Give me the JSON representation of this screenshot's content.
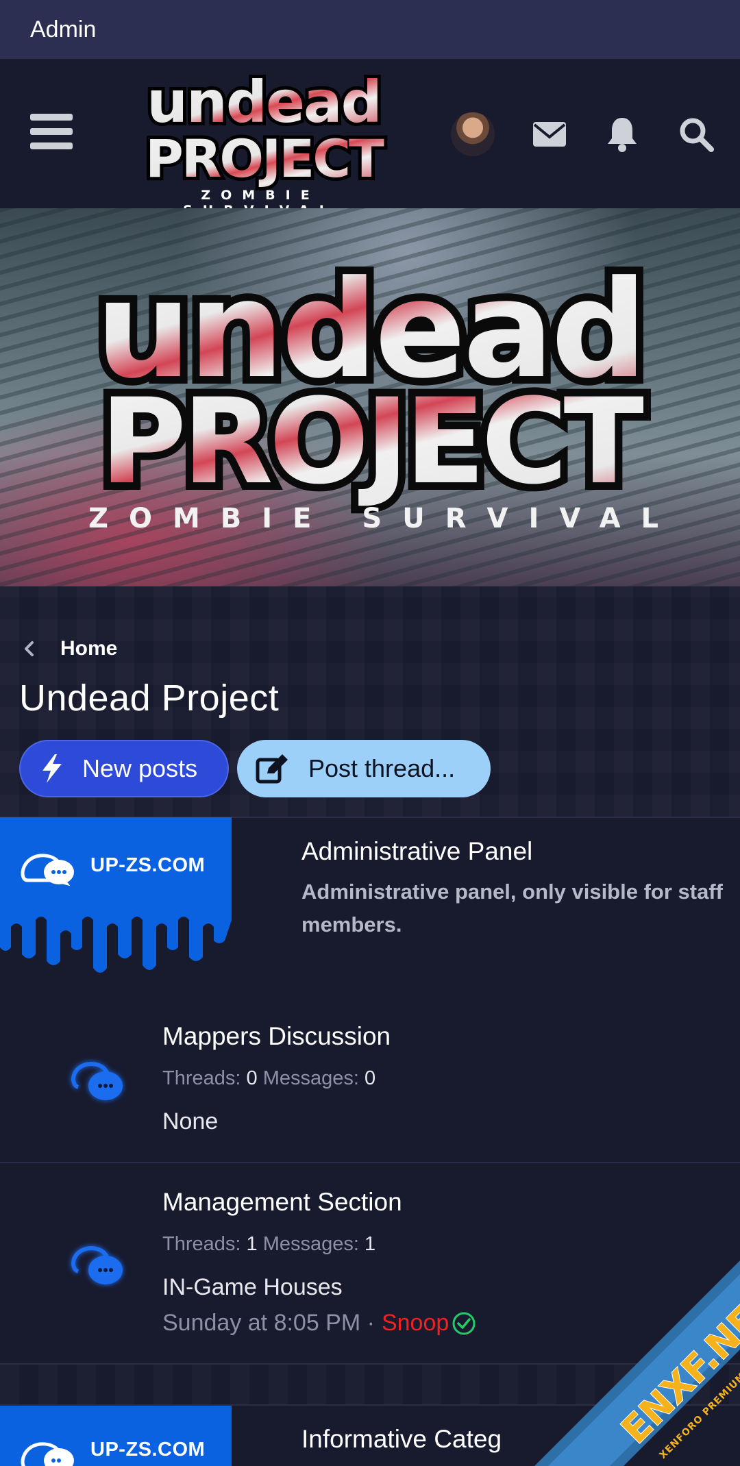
{
  "admin_bar": {
    "label": "Admin"
  },
  "header": {
    "logo_line1": "undead",
    "logo_line2": "PROJECT",
    "logo_sub": "ZOMBIE SURVIVAL",
    "icons": [
      "menu-icon",
      "avatar",
      "envelope-icon",
      "bell-icon",
      "search-icon"
    ]
  },
  "banner": {
    "line1": "undead",
    "line2": "PROJECT",
    "sub": "ZOMBIE SURVIVAL"
  },
  "breadcrumb": {
    "label": "Home"
  },
  "page_title": "Undead Project",
  "buttons": {
    "new_posts": "New posts",
    "post_thread": "Post thread..."
  },
  "categories": [
    {
      "image_label": "UP-ZS.COM",
      "title": "Administrative Panel",
      "description": "Administrative panel, only visible for staff members."
    },
    {
      "image_label": "UP-ZS.COM",
      "title": "Informative Categ"
    }
  ],
  "forums": [
    {
      "title": "Mappers Discussion",
      "threads_label": "Threads:",
      "threads": "0",
      "messages_label": "Messages:",
      "messages": "0",
      "last_post": "None"
    },
    {
      "title": "Management Section",
      "threads_label": "Threads:",
      "threads": "1",
      "messages_label": "Messages:",
      "messages": "1",
      "last_post": "IN-Game Houses",
      "last_time": "Sunday at 8:05 PM ·",
      "last_user": "Snoop"
    }
  ],
  "watermark": {
    "main": "ENXF.NET",
    "sub": "XENFORO PREMIUM COMMUNITY"
  },
  "colors": {
    "admin_bar": "#2c2f52",
    "background": "#181a2e",
    "new_posts_button": "#2d4ad8",
    "post_thread_button": "#9dd0f8",
    "category_plate": "#0b62e0",
    "username": "#ee2222",
    "verified": "#22cc66"
  }
}
